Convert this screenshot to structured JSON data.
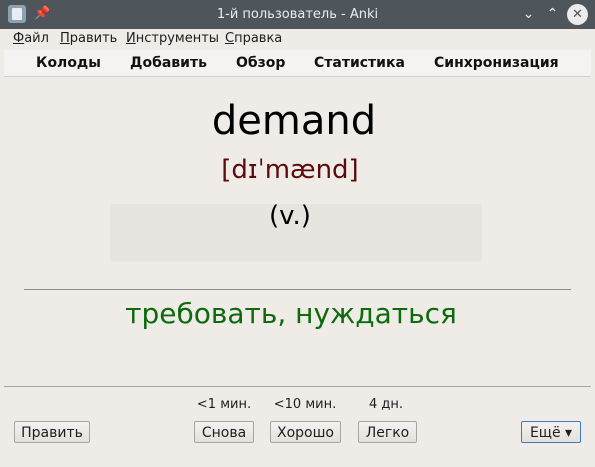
{
  "window": {
    "title": "1-й пользователь - Anki",
    "icons": {
      "app": "anki-app-icon",
      "pin": "pin-icon",
      "minimize": "chevron-down-icon",
      "maximize": "chevron-up-icon",
      "close": "close-icon"
    },
    "glyphs": {
      "pin": "📌",
      "minimize": "⌄",
      "maximize": "⌃",
      "close": "✕"
    }
  },
  "menu": {
    "file": {
      "first": "Ф",
      "rest": "айл"
    },
    "edit": {
      "first": "П",
      "rest": "равить"
    },
    "tools": {
      "first": "И",
      "rest": "нструменты"
    },
    "help": {
      "first": "С",
      "rest": "правка"
    }
  },
  "toolbar": {
    "decks": "Колоды",
    "add": "Добавить",
    "browse": "Обзор",
    "stats": "Статистика",
    "sync": "Синхронизация"
  },
  "card": {
    "word": "demand",
    "ipa": "[dɪˈmænd]",
    "part_of_speech": "(v.)",
    "translation": "требовать, нуждаться"
  },
  "answer_bar": {
    "edit_label": "Править",
    "intervals": {
      "again": "<1 мин.",
      "good": "<10 мин.",
      "easy": "4 дн."
    },
    "again_label": "Снова",
    "good_label": "Хорошо",
    "easy_label": "Легко",
    "more_label": "Ещё ▾"
  },
  "colors": {
    "titlebar": "#4f565b",
    "background": "#efebe7",
    "ipa": "#5a0b0b",
    "translation": "#0d6a0d",
    "focus_border": "#3b7bc4"
  }
}
